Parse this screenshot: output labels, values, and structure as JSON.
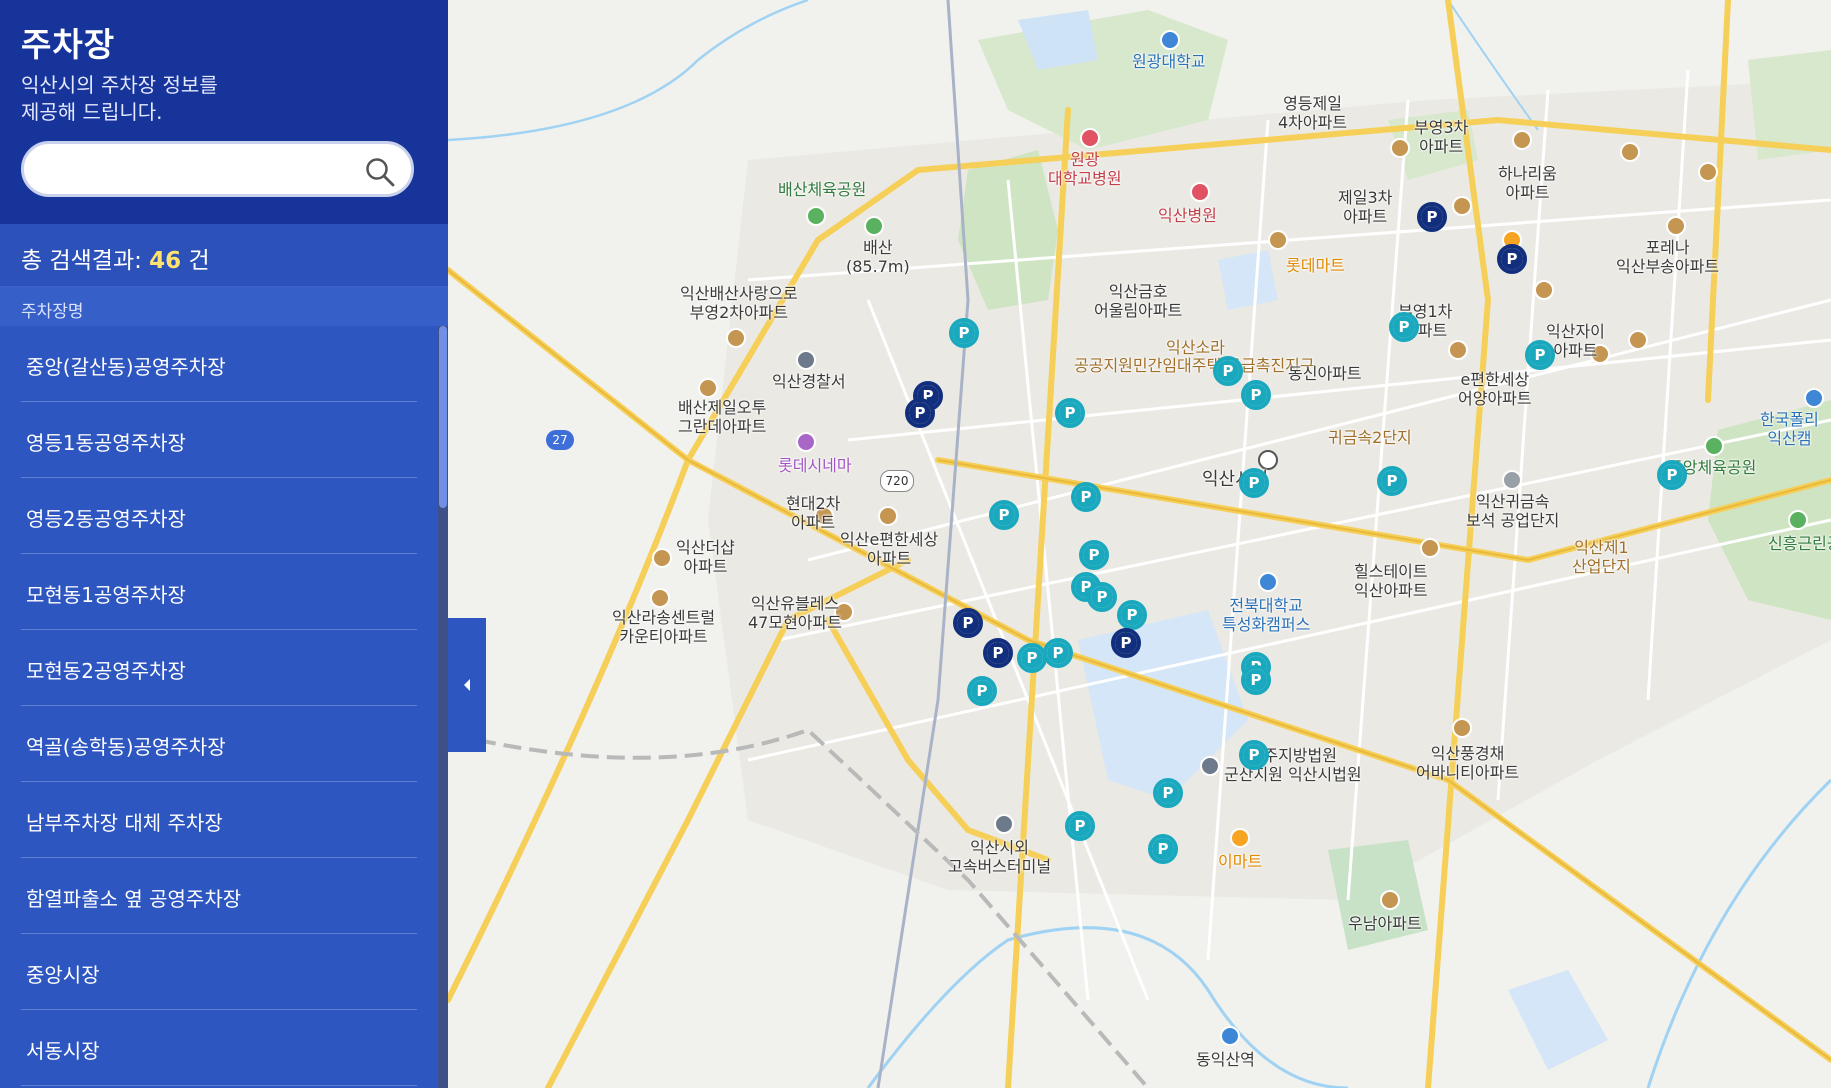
{
  "sidebar": {
    "title": "주차장",
    "description": "익산시의 주차장 정보를\n제공해 드립니다.",
    "search": {
      "value": "",
      "placeholder": ""
    },
    "result": {
      "prefix": "총 검색결과: ",
      "count": "46",
      "suffix": " 건"
    },
    "column_header": "주차장명",
    "items": [
      "중앙(갈산동)공영주차장",
      "영등1동공영주차장",
      "영등2동공영주차장",
      "모현동1공영주차장",
      "모현동2공영주차장",
      "역골(송학동)공영주차장",
      "남부주차장 대체 주차장",
      "함열파출소 옆 공영주차장",
      "중앙시장",
      "서동시장"
    ]
  },
  "map": {
    "labels": {
      "wonkwang_univ": "원광대학교",
      "wonkwang_hospital": "원광\n대학교병원",
      "iksan_hospital": "익산병원",
      "baesan_park": "배산체육공원",
      "baesan_mt": "배산\n(85.7m)",
      "baesan_apt": "익산배산사랑으로\n부영2차아파트",
      "police": "익산경찰서",
      "baesan_jeil": "배산제일오투\n그란데아파트",
      "lotte_cinema": "롯데시네마",
      "hyundai2": "현대2차\n아파트",
      "ecity": "익산e편한세상\n아파트",
      "deosharp": "익산더샵\n아파트",
      "rasong": "익산라송센트럴\n카운티아파트",
      "ubless": "익산유블레스\n47모현아파트",
      "geumho": "익산금호\n어울림아파트",
      "sora": "익산소라",
      "public_support": "공공지원민간임대주택 공급촉진지구",
      "dongsin": "동신아파트",
      "youngdeung_jeil": "영등제일\n4차아파트",
      "booyoung3": "부영3차\n아파트",
      "jeil3": "제일3차\n아파트",
      "lotte_mart": "롯데마트",
      "hanarium": "하나리움\n아파트",
      "porena": "포레나\n익산부송아파트",
      "booyoung1": "부영1차\n아파트",
      "iksan_xi": "익산자이\n아파트",
      "ecity_eoyang": "e편한세상\n어양아파트",
      "polytech": "한국폴리\n익산캠",
      "gwigeumsok2": "귀금속2단지",
      "iksan_city": "익산시청",
      "gwigeumsok": "익산귀금속\n보석 공업단지",
      "stadium": "중앙체육공원",
      "sinheung_park": "신흥근린공",
      "industrial1": "익산제1\n산업단지",
      "hillstate": "힐스테이트\n익산아파트",
      "jbnu": "전북대학교\n특성화캠퍼스",
      "court": "전주지방법원\n군산지원 익산시법원",
      "pungkyung": "익산풍경채\n어바니티아파트",
      "bus_terminal": "익산시외\n고속버스터미널",
      "emart": "이마트",
      "woonam": "우남아파트",
      "dongiksan": "동익산역"
    },
    "route_badges": [
      "27",
      "720"
    ]
  },
  "colors": {
    "sidebar_header": "#17349a",
    "sidebar_body": "#2e56c0",
    "result_count": "#ffe36e",
    "pin_teal": "#19a8be",
    "pin_navy": "#122f7e"
  }
}
